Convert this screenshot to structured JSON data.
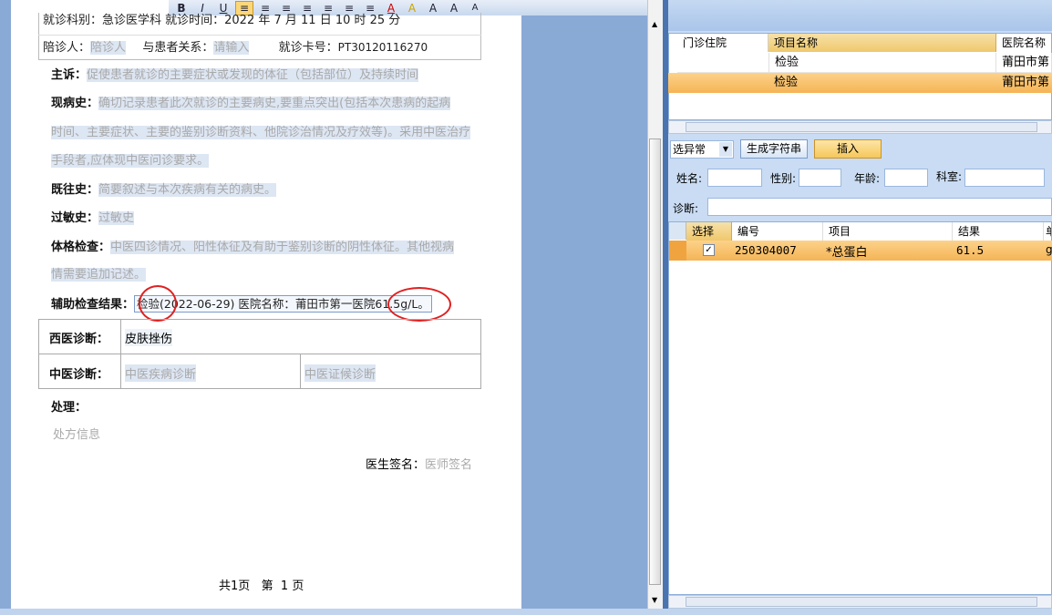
{
  "toolbar": {
    "items": [
      "B",
      "I",
      "U",
      "≡",
      "≡",
      "≡",
      "≡",
      "≡",
      "≡",
      "≡",
      "A",
      "A",
      "A",
      "A",
      "A"
    ]
  },
  "header": {
    "line1": "就诊科别：急诊医学科 就诊时间：2022 年 7 月 11 日 10 时 25 分",
    "escort_label": "陪诊人：",
    "escort_ph": "陪诊人",
    "relation_label": "与患者关系：",
    "relation_ph": "请输入",
    "card_label": "就诊卡号：",
    "card_value": "PT30120116270"
  },
  "record": {
    "complaint_label": "主诉：",
    "complaint_ph": "促使患者就诊的主要症状或发现的体征（包括部位）及持续时间",
    "history_label": "现病史：",
    "history_ph_1": "确切记录患者此次就诊的主要病史,要重点突出(包括本次患病的起病",
    "history_ph_2": "时间、主要症状、主要的鉴别诊断资料、他院诊治情况及疗效等)。采用中医治疗",
    "history_ph_3": "手段者,应体现中医问诊要求。",
    "past_label": "既往史：",
    "past_ph": "简要叙述与本次疾病有关的病史。",
    "allergy_label": "过敏史：",
    "allergy_ph": "过敏史",
    "exam_label": "体格检查：",
    "exam_ph_1": "中医四诊情况、阳性体征及有助于鉴别诊断的阴性体征。其他视病",
    "exam_ph_2": "情需要追加记述。",
    "aux_label": "辅助检查结果：",
    "aux_value": "检验(2022-06-29) 医院名称：莆田市第一医院61.5g/L。",
    "western_label": "西医诊断：",
    "western_value": "皮肤挫伤",
    "tcm_label": "中医诊断：",
    "tcm_disease_ph": "中医疾病诊断",
    "tcm_syndrome_ph": "中医证候诊断",
    "treatment_label": "处理：",
    "rx_ph": "处方信息",
    "sign_label": "医生签名：",
    "sign_ph": "医师签名",
    "pages": "共1页   第  1 页"
  },
  "top_table": {
    "headers": [
      "门诊住院",
      "项目名称",
      "医院名称"
    ],
    "rows": [
      [
        "",
        "检验",
        "莆田市第"
      ],
      [
        "",
        "检验",
        "莆田市第"
      ]
    ]
  },
  "controls": {
    "select_value": "选异常",
    "gen_button": "生成字符串",
    "insert_button": "插入",
    "name_label": "姓名:",
    "gender_label": "性别:",
    "age_label": "年龄:",
    "dept_label": "科室:",
    "diag_label": "诊断:"
  },
  "bottom_table": {
    "headers": [
      "选择",
      "编号",
      "项目",
      "结果",
      "单"
    ],
    "rows": [
      [
        "",
        "250304007",
        "*总蛋白",
        "61.5",
        "g"
      ]
    ]
  },
  "colors": {
    "accent": "#f0c86c",
    "selected_row": "#f5b455",
    "circle": "#e02020"
  }
}
